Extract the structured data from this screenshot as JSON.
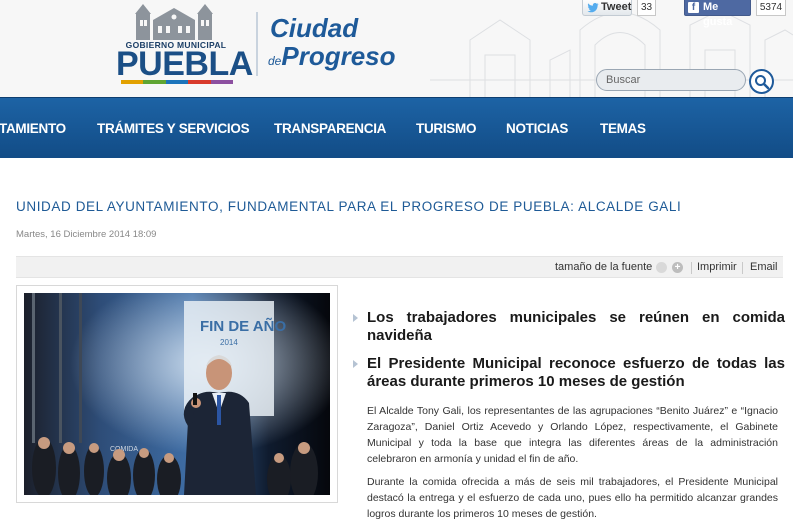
{
  "header": {
    "logo": {
      "subtitle": "GOBIERNO MUNICIPAL",
      "name": "PUEBLA"
    },
    "slogan": {
      "line1": "Ciudad",
      "line2_small": "de",
      "line2": "Progreso"
    },
    "social": {
      "tweet_label": "Tweet",
      "tweet_count": "33",
      "like_label": "Me gusta",
      "like_count": "5374"
    },
    "search": {
      "placeholder": "Buscar"
    }
  },
  "nav": {
    "items": [
      {
        "label": "TAMIENTO"
      },
      {
        "label": "TRÁMITES Y SERVICIOS"
      },
      {
        "label": "TRANSPARENCIA"
      },
      {
        "label": "TURISMO"
      },
      {
        "label": "NOTICIAS"
      },
      {
        "label": "TEMAS"
      }
    ]
  },
  "article": {
    "title": "UNIDAD DEL AYUNTAMIENTO, FUNDAMENTAL PARA EL PROGRESO DE PUEBLA: ALCALDE GALI",
    "date": "Martes, 16 Diciembre 2014 18:09",
    "tools": {
      "font_size_label": "tamaño de la fuente",
      "print_label": "Imprimir",
      "email_label": "Email"
    },
    "headlines": [
      "Los trabajadores municipales se reúnen en comida navideña",
      "El Presidente Municipal reconoce esfuerzo de todas las áreas durante primeros 10 meses de gestión"
    ],
    "paragraphs": [
      "El Alcalde Tony Gali, los representantes de las agrupaciones “Benito Juárez” e “Ignacio Zaragoza”, Daniel Ortiz Acevedo y Orlando López, respectivamente, el Gabinete Municipal y toda la base que integra las diferentes áreas de la administración celebraron en armonía y unidad el fin de año.",
      "Durante la comida ofrecida a más de seis mil trabajadores, el Presidente Municipal destacó la entrega y el esfuerzo de cada uno, pues ello ha permitido alcanzar grandes logros durante los primeros 10 meses de gestión."
    ],
    "photo": {
      "backdrop_text": "FIN DE AÑO",
      "backdrop_year": "2014",
      "side_text": "COMIDA"
    }
  },
  "colors": {
    "nav_blue": "#1a5a9b",
    "title_blue": "#1e5a96",
    "facebook": "#4e69a2",
    "twitter": "#55acee"
  }
}
